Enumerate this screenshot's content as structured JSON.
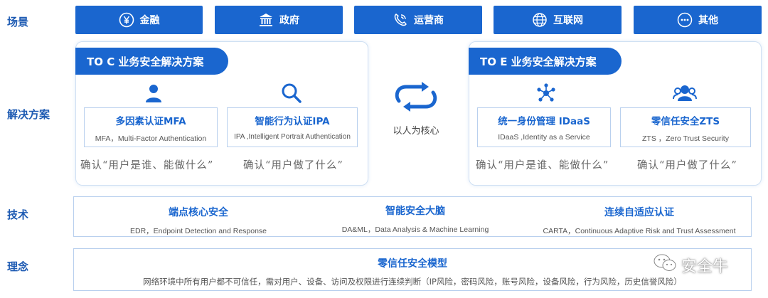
{
  "rows": {
    "scenario": "场景",
    "solution": "解决方案",
    "technology": "技术",
    "concept": "理念"
  },
  "scenarios": [
    {
      "label": "金融",
      "icon": "yen-circle-icon"
    },
    {
      "label": "政府",
      "icon": "government-building-icon"
    },
    {
      "label": "运营商",
      "icon": "phone-icon"
    },
    {
      "label": "互联网",
      "icon": "globe-icon"
    },
    {
      "label": "其他",
      "icon": "more-dots-icon"
    }
  ],
  "toc": {
    "title": "TO C 业务安全解决方案",
    "cards": [
      {
        "title": "多因素认证MFA",
        "subtitle": "MFA，Multi-Factor Authentication",
        "icon": "user-icon",
        "confirm": "确认“用户是谁、能做什么”"
      },
      {
        "title": "智能行为认证IPA",
        "subtitle": "IPA ,Intelligent Portrait Authentication",
        "icon": "search-icon",
        "confirm": "确认“用户做了什么”"
      }
    ]
  },
  "core": {
    "label": "以人为核心",
    "icon": "cycle-arrows-icon"
  },
  "toe": {
    "title": "TO E 业务安全解决方案",
    "cards": [
      {
        "title": "统一身份管理 IDaaS",
        "subtitle": "IDaaS ,Identity as a Service",
        "icon": "network-nodes-icon",
        "confirm": "确认“用户是谁、能做什么”"
      },
      {
        "title": "零信任安全ZTS",
        "subtitle": "ZTS ，Zero Trust Security",
        "icon": "user-group-icon",
        "confirm": "确认“用户做了什么”"
      }
    ]
  },
  "technology": [
    {
      "title": "端点核心安全",
      "subtitle": "EDR，Endpoint Detection and Response"
    },
    {
      "title": "智能安全大脑",
      "subtitle": "DA&ML，Data Analysis & Machine Learning"
    },
    {
      "title": "连续自适应认证",
      "subtitle": "CARTA，Continuous Adaptive Risk and Trust Assessment"
    }
  ],
  "concept": {
    "title": "零信任安全模型",
    "subtitle": "网络环境中所有用户都不可信任，需对用户、设备、访问及权限进行连续判断（IP风险，密码风险，账号风险，设备风险，行为风险，历史信誉风险）"
  },
  "watermark": {
    "text": "安全牛",
    "icon": "wechat-icon"
  },
  "colors": {
    "primary": "#1a66cf",
    "label": "#1e5bb3",
    "border": "#b9d0ee"
  }
}
